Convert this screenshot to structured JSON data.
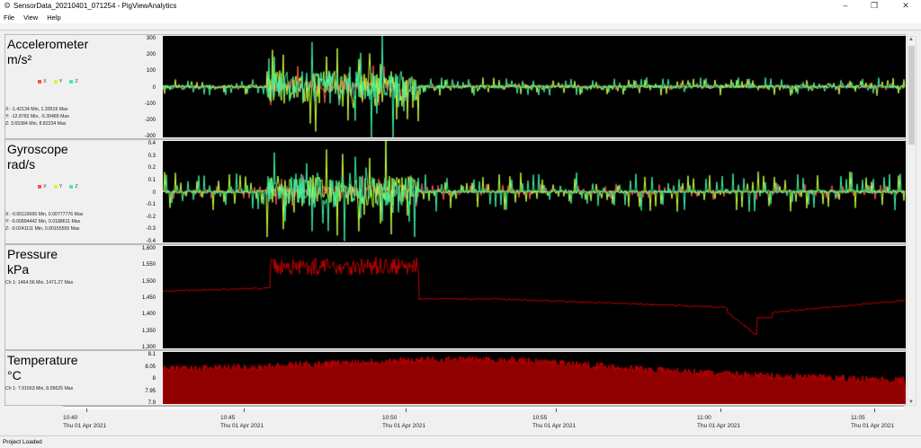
{
  "window": {
    "title": "SensorData_20210401_071254 - PigViewAnalytics",
    "minimize": "–",
    "restore": "❐",
    "close": "✕"
  },
  "menu": [
    "File",
    "View",
    "Help"
  ],
  "panels": [
    {
      "id": "accel",
      "title": "Accelerometer",
      "unit": "m/s²",
      "legend": [
        "X",
        "Y",
        "Z"
      ],
      "stats": [
        "X: -1.42134 Min, 1.33519 Max",
        "Y: -12.8782 Min, -5.30489 Max",
        "Z: 3.65384 Min, 8.82234 Max"
      ],
      "yticks": [
        "300",
        "200",
        "100",
        "0",
        "-100",
        "-200",
        "-300"
      ],
      "ylim": [
        -300,
        300
      ]
    },
    {
      "id": "gyro",
      "title": "Gyroscope",
      "unit": "rad/s",
      "legend": [
        "X",
        "Y",
        "Z"
      ],
      "stats": [
        "X: -0.00116666 Min, 0.00777776 Max",
        "Y: -0.00894442 Min, 0.0188611 Max",
        "Z: -0.0241111 Min, 0.00155555 Max"
      ],
      "yticks": [
        "0.4",
        "0.3",
        "0.2",
        "0.1",
        "0",
        "-0.1",
        "-0.2",
        "-0.3",
        "-0.4"
      ],
      "ylim": [
        -0.4,
        0.4
      ]
    },
    {
      "id": "pressure",
      "title": "Pressure",
      "unit": "kPa",
      "legend": [],
      "stats": [
        "Ch 1: 1464.56 Min, 1471.27 Max"
      ],
      "yticks": [
        "1,600",
        "1,550",
        "1,500",
        "1,450",
        "1,400",
        "1,350",
        "1,300"
      ],
      "ylim": [
        1300,
        1600
      ]
    },
    {
      "id": "temp",
      "title": "Temperature",
      "unit": "°C",
      "legend": [],
      "stats": [
        "Ch 1: 7.91563 Min, 8.05625 Max"
      ],
      "yticks": [
        "8.1",
        "8.05",
        "8",
        "7.95",
        "7.9"
      ],
      "ylim": [
        7.9,
        8.1
      ]
    }
  ],
  "colors": {
    "x": "#ff5050",
    "y": "#c8ff3c",
    "z": "#3cf0a0",
    "channel": "#c00000"
  },
  "time_axis": [
    {
      "time": "10:40",
      "date": "Thu 01 Apr 2021"
    },
    {
      "time": "10:45",
      "date": "Thu 01 Apr 2021"
    },
    {
      "time": "10:50",
      "date": "Thu 01 Apr 2021"
    },
    {
      "time": "10:55",
      "date": "Thu 01 Apr 2021"
    },
    {
      "time": "11:00",
      "date": "Thu 01 Apr 2021"
    },
    {
      "time": "11:05",
      "date": "Thu 01 Apr 2021"
    }
  ],
  "status": "Project Loaded"
}
